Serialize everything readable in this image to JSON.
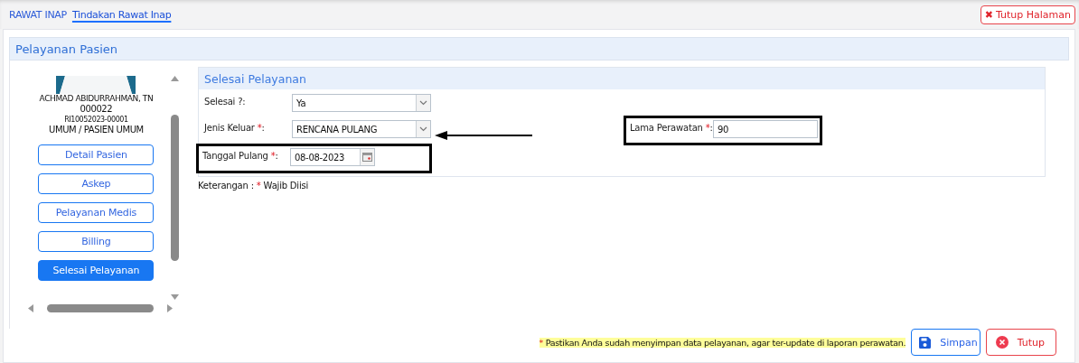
{
  "breadcrumb": [
    {
      "label": "RAWAT INAP",
      "selected": false
    },
    {
      "label": "Tindakan Rawat Inap",
      "selected": true
    }
  ],
  "close_page_button": {
    "icon": "✖",
    "label": "Tutup Halaman"
  },
  "panel": {
    "title": "Pelayanan Pasien"
  },
  "patient": {
    "name": "ACHMAD ABIDURRAHMAN, TN",
    "number": "000022",
    "registration": "RI10052023-00001",
    "category": "UMUM / PASIEN UMUM"
  },
  "sidebar": {
    "items": [
      {
        "label": "Detail Pasien",
        "selected": false
      },
      {
        "label": "Askep",
        "selected": false
      },
      {
        "label": "Pelayanan Medis",
        "selected": false
      },
      {
        "label": "Billing",
        "selected": false
      },
      {
        "label": "Selesai Pelayanan",
        "selected": true
      }
    ]
  },
  "form": {
    "title": "Selesai Pelayanan",
    "left_fields": [
      {
        "kind": "select",
        "label": "Selesai ?",
        "tail": ":",
        "value": "Ya",
        "outlined": false
      },
      {
        "kind": "select",
        "label": "Jenis Keluar ",
        "mark": "*",
        "tail": ":",
        "value": "RENCANA PULANG",
        "outlined": false,
        "pointer": true
      },
      {
        "kind": "date",
        "label": "Tanggal Pulang ",
        "mark": "*",
        "tail": ":",
        "value": "08-08-2023",
        "outlined": true
      }
    ],
    "right_fields": [
      {
        "kind": "text",
        "label": "Lama Perawatan ",
        "mark": "*",
        "tail": ":",
        "value": "90",
        "outlined": true
      }
    ],
    "legend": {
      "label": "Keterangan : ",
      "mark": "*",
      "text": " Wajib Diisi"
    }
  },
  "footer": {
    "note_mark": "*",
    "note": " Pastikan Anda sudah menyimpan data pelayanan, agar ter-update di laporan perawatan.",
    "buttons": [
      {
        "kind": "save",
        "label": "Simpan"
      },
      {
        "kind": "close",
        "label": "Tutup"
      }
    ]
  }
}
